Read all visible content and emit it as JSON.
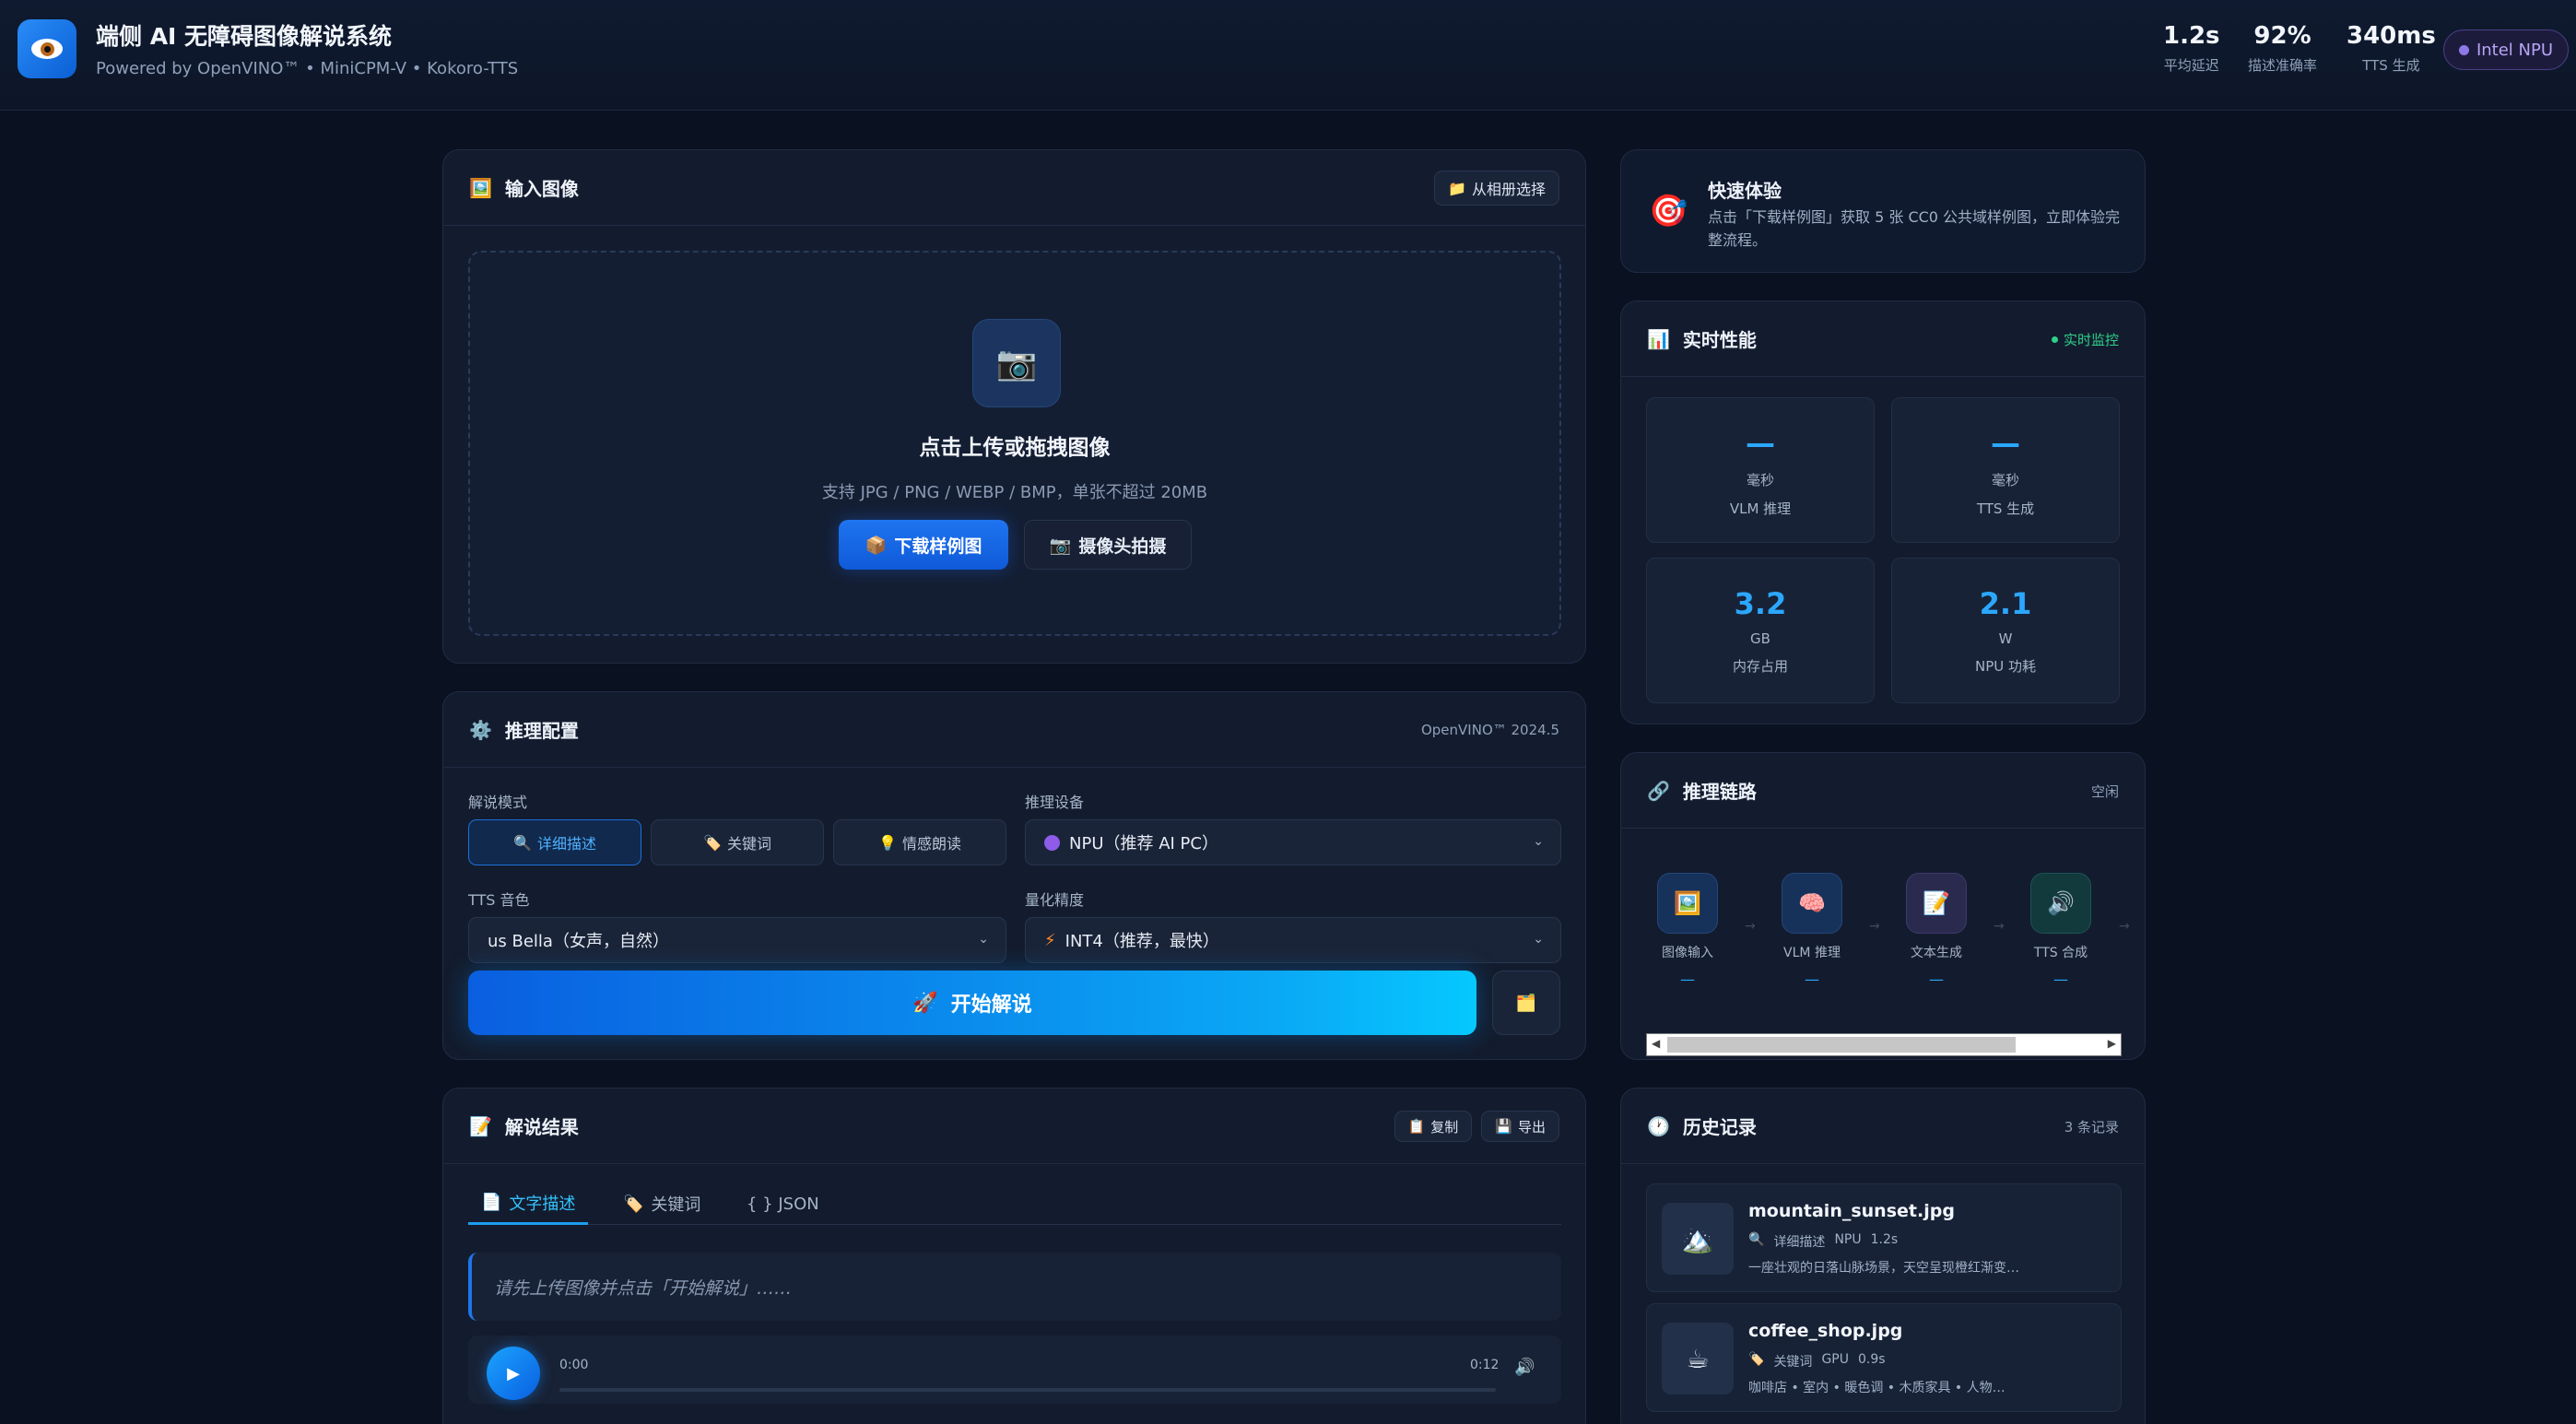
{
  "header": {
    "title": "端侧 AI 无障碍图像解说系统",
    "subtitle": "Powered by OpenVINO™ • MiniCPM-V • Kokoro-TTS",
    "stats": [
      {
        "value": "1.2s",
        "label": "平均延迟"
      },
      {
        "value": "92%",
        "label": "描述准确率"
      },
      {
        "value": "340ms",
        "label": "TTS 生成"
      }
    ],
    "device_badge": "Intel NPU"
  },
  "input_card": {
    "title": "输入图像",
    "album_button": "从相册选择",
    "drop_title": "点击上传或拖拽图像",
    "drop_hint": "支持 JPG / PNG / WEBP / BMP，单张不超过 20MB",
    "download_samples": "下载样例图",
    "camera_button": "摄像头拍摄"
  },
  "config_card": {
    "title": "推理配置",
    "version": "OpenVINO™ 2024.5",
    "mode_label": "解说模式",
    "modes": [
      "详细描述",
      "关键词",
      "情感朗读"
    ],
    "device_label": "推理设备",
    "device_value": "NPU（推荐 AI PC）",
    "voice_label": "TTS 音色",
    "voice_value": "us Bella（女声，自然）",
    "quant_label": "量化精度",
    "quant_value": "INT4（推荐，最快）",
    "start_button": "开始解说"
  },
  "result_card": {
    "title": "解说结果",
    "copy_button": "复制",
    "export_button": "导出",
    "tabs": [
      "文字描述",
      "关键词",
      "{ } JSON"
    ],
    "placeholder": "请先上传图像并点击「开始解说」……",
    "time_start": "0:00",
    "time_end": "0:12"
  },
  "quick_card": {
    "title": "快速体验",
    "desc": "点击「下载样例图」获取 5 张 CC0 公共域样例图，立即体验完整流程。"
  },
  "perf_card": {
    "title": "实时性能",
    "live": "实时监控",
    "metrics": [
      {
        "value": "—",
        "unit": "毫秒",
        "label": "VLM 推理"
      },
      {
        "value": "—",
        "unit": "毫秒",
        "label": "TTS 生成"
      },
      {
        "value": "3.2",
        "unit": "GB",
        "label": "内存占用"
      },
      {
        "value": "2.1",
        "unit": "W",
        "label": "NPU 功耗"
      }
    ]
  },
  "pipeline_card": {
    "title": "推理链路",
    "status": "空闲",
    "nodes": [
      {
        "label": "图像输入",
        "value": "—"
      },
      {
        "label": "VLM 推理",
        "value": "—"
      },
      {
        "label": "文本生成",
        "value": "—"
      },
      {
        "label": "TTS 合成",
        "value": "—"
      }
    ]
  },
  "history_card": {
    "title": "历史记录",
    "count": "3 条记录",
    "items": [
      {
        "name": "mountain_sunset.jpg",
        "mode": "详细描述",
        "device": "NPU",
        "time": "1.2s",
        "desc": "一座壮观的日落山脉场景，天空呈现橙红渐变…"
      },
      {
        "name": "coffee_shop.jpg",
        "mode": "关键词",
        "device": "GPU",
        "time": "0.9s",
        "desc": "咖啡店 • 室内 • 暖色调 • 木质家具 • 人物…"
      }
    ]
  },
  "colors": {
    "accent": "#1e75e8",
    "accent_bright": "#2ba7ff",
    "live": "#2fd08a",
    "npu": "#b7a5f5",
    "background": "#0a1120",
    "card": "#131c2e"
  }
}
